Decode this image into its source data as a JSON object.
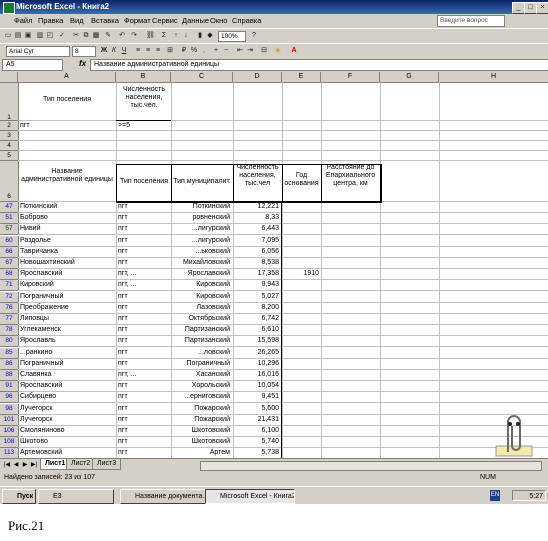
{
  "window": {
    "title": "Microsoft Excel - Книга2",
    "help_placeholder": "Введите вопрос"
  },
  "menu": [
    "Файл",
    "Правка",
    "Вид",
    "Вставка",
    "Формат",
    "Сервис",
    "Данные",
    "Окно",
    "Справка"
  ],
  "toolbar": {
    "font_name": "Arial Cyr",
    "font_size": "8",
    "zoom": "100%"
  },
  "formula": {
    "name_box": "A5",
    "fx": "fx",
    "value": "Название административной единицы"
  },
  "columns": [
    "A",
    "B",
    "C",
    "D",
    "E",
    "F",
    "G",
    "H"
  ],
  "header_top": {
    "A1": "Тип поселения",
    "B1": "Численность населения, тыс.чел.",
    "A2": "пгт",
    "B2": ">=5"
  },
  "table_header": {
    "A6": "Название административной единицы",
    "B6": "Тип поселения",
    "C6": "Тип муниципалит.",
    "D6": "Численность населения, тыс.чел",
    "E6": "Год основания",
    "F6": "Расстояние до Епархиального центра, км"
  },
  "rows": [
    {
      "n": "47",
      "a": "Поткинский",
      "b": "пгт",
      "c": "Поткинский",
      "d": "12,221",
      "e": ""
    },
    {
      "n": "51",
      "a": "Боброво",
      "b": "пгт",
      "c": "ровненский",
      "d": "8,33",
      "e": ""
    },
    {
      "n": "57",
      "a": "Нивий",
      "b": "пгт",
      "c": "...лигурский",
      "d": "6,443",
      "e": ""
    },
    {
      "n": "60",
      "a": "Раздолье",
      "b": "пгт",
      "c": "...лигурский",
      "d": "7,095",
      "e": ""
    },
    {
      "n": "66",
      "a": "Тавричанка",
      "b": "пгт",
      "c": "...ьковский",
      "d": "6,056",
      "e": ""
    },
    {
      "n": "67",
      "a": "Новошахтинский",
      "b": "пгт",
      "c": "Михайловский",
      "d": "8,538",
      "e": ""
    },
    {
      "n": "68",
      "a": "Ярославский",
      "b": "пгт, ...",
      "c": "Ярославский",
      "d": "17,358",
      "e": "1910"
    },
    {
      "n": "71",
      "a": "Кировский",
      "b": "пгт, ...",
      "c": "Кировский",
      "d": "9,943",
      "e": ""
    },
    {
      "n": "72",
      "a": "Пограничный",
      "b": "пгт",
      "c": "Кировский",
      "d": "5,027",
      "e": ""
    },
    {
      "n": "76",
      "a": "Преображение",
      "b": "пгт",
      "c": "Лазовский",
      "d": "8,200",
      "e": ""
    },
    {
      "n": "77",
      "a": "Липовцы",
      "b": "пгт",
      "c": "Октябрьский",
      "d": "6,742",
      "e": ""
    },
    {
      "n": "78",
      "a": "Углекаменск",
      "b": "пгт",
      "c": "Партизанский",
      "d": "6,610",
      "e": ""
    },
    {
      "n": "80",
      "a": "Ярославль",
      "b": "пгт",
      "c": "Партизанский",
      "d": "15,598",
      "e": ""
    },
    {
      "n": "85",
      "a": "...ранкино",
      "b": "пгт",
      "c": "...ловский",
      "d": "26,265",
      "e": ""
    },
    {
      "n": "86",
      "a": "Пограничный",
      "b": "пгт",
      "c": "Пограничный",
      "d": "10,296",
      "e": ""
    },
    {
      "n": "88",
      "a": "Славянка",
      "b": "пгт, ...",
      "c": "Хасанский",
      "d": "16,016",
      "e": ""
    },
    {
      "n": "91",
      "a": "Ярославский",
      "b": "пгт",
      "c": "Хорольский",
      "d": "10,054",
      "e": ""
    },
    {
      "n": "96",
      "a": "Сибирцево",
      "b": "пгт",
      "c": "...ерниговский",
      "d": "9,451",
      "e": ""
    },
    {
      "n": "98",
      "a": "Лучегорск",
      "b": "пгт",
      "c": "Пожарский",
      "d": "5,600",
      "e": ""
    },
    {
      "n": "101",
      "a": "Лучегорск",
      "b": "пгт",
      "c": "Пожарский",
      "d": "21,431",
      "e": ""
    },
    {
      "n": "106",
      "a": "Смоляниново",
      "b": "пгт",
      "c": "Шкотовский",
      "d": "6,100",
      "e": ""
    },
    {
      "n": "108",
      "a": "Шкотово",
      "b": "пгт",
      "c": "Шкотовский",
      "d": "5,740",
      "e": ""
    },
    {
      "n": "113",
      "a": "Артемовский",
      "b": "пгт",
      "c": "Артем",
      "d": "5,738",
      "e": ""
    }
  ],
  "sheet_tabs": [
    "Лист1",
    "Лист2",
    "Лист3"
  ],
  "status": {
    "left": "Найдено записей: 23 из 107",
    "right": "NUM"
  },
  "taskbar": {
    "start": "Пуск",
    "items": [
      "E3",
      "Название документа...",
      "Microsoft Excel - Книга2"
    ],
    "lang": "EN",
    "clock": "5:27"
  },
  "caption": "Рис.21"
}
